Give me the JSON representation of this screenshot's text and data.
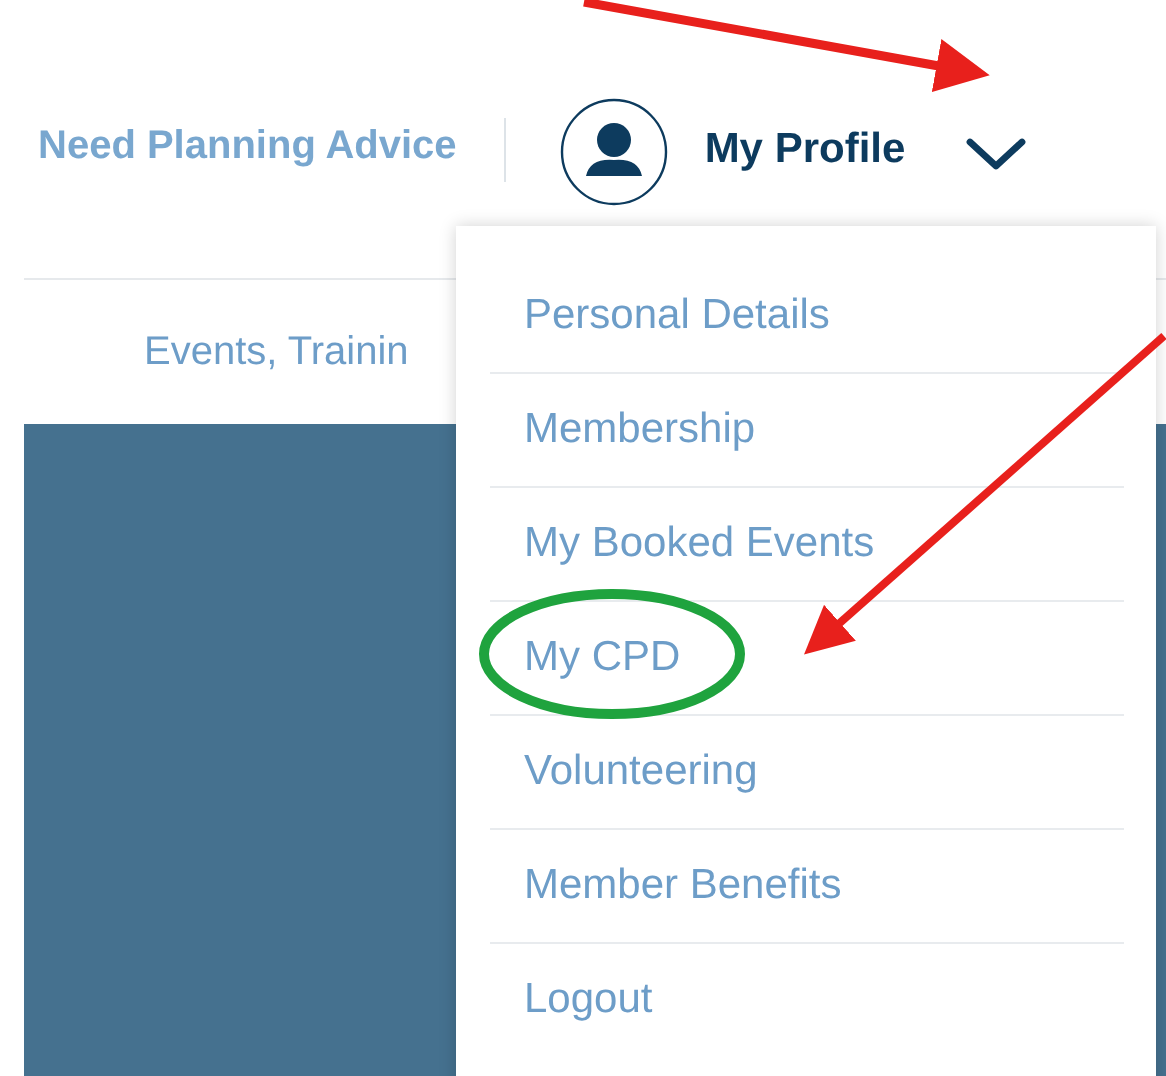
{
  "header": {
    "advice_link": "Need Planning Advice",
    "profile_label": "My Profile"
  },
  "subnav": {
    "label": "Events, Trainin"
  },
  "profile_menu": {
    "expanded": true,
    "items": [
      {
        "label": "Personal Details"
      },
      {
        "label": "Membership"
      },
      {
        "label": "My Booked Events"
      },
      {
        "label": "My CPD"
      },
      {
        "label": "Volunteering"
      },
      {
        "label": "Member Benefits"
      },
      {
        "label": "Logout"
      }
    ]
  }
}
